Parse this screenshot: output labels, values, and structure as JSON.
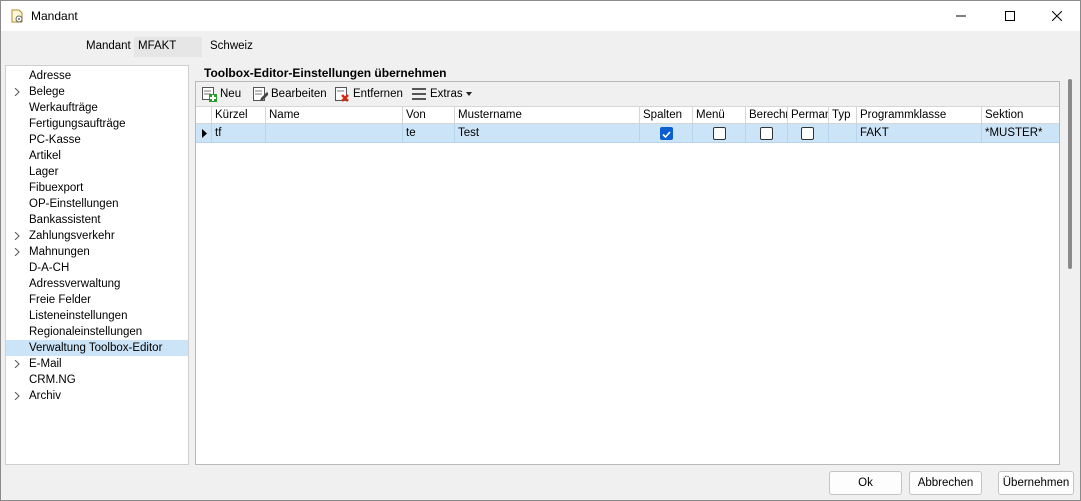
{
  "window": {
    "title": "Mandant"
  },
  "mandant": {
    "label": "Mandant",
    "code": "MFAKT",
    "name": "Schweiz"
  },
  "nav": {
    "items": [
      {
        "label": "Adresse",
        "expandable": false
      },
      {
        "label": "Belege",
        "expandable": true
      },
      {
        "label": "Werkaufträge",
        "expandable": false
      },
      {
        "label": "Fertigungsaufträge",
        "expandable": false
      },
      {
        "label": "PC-Kasse",
        "expandable": false
      },
      {
        "label": "Artikel",
        "expandable": false
      },
      {
        "label": "Lager",
        "expandable": false
      },
      {
        "label": "Fibuexport",
        "expandable": false
      },
      {
        "label": "OP-Einstellungen",
        "expandable": false
      },
      {
        "label": "Bankassistent",
        "expandable": false
      },
      {
        "label": "Zahlungsverkehr",
        "expandable": true
      },
      {
        "label": "Mahnungen",
        "expandable": true
      },
      {
        "label": "D-A-CH",
        "expandable": false
      },
      {
        "label": "Adressverwaltung",
        "expandable": false
      },
      {
        "label": "Freie Felder",
        "expandable": false
      },
      {
        "label": "Listeneinstellungen",
        "expandable": false
      },
      {
        "label": "Regionaleinstellungen",
        "expandable": false
      },
      {
        "label": "Verwaltung Toolbox-Editor",
        "expandable": false,
        "selected": true
      },
      {
        "label": "E-Mail",
        "expandable": true
      },
      {
        "label": "CRM.NG",
        "expandable": false
      },
      {
        "label": "Archiv",
        "expandable": true
      }
    ]
  },
  "panel": {
    "title": "Toolbox-Editor-Einstellungen übernehmen"
  },
  "toolbar": {
    "new": "Neu",
    "edit": "Bearbeiten",
    "remove": "Entfernen",
    "extras": "Extras"
  },
  "table": {
    "columns": [
      "Kürzel",
      "Name",
      "Von",
      "Mustername",
      "Spalten",
      "Menü",
      "Berechn",
      "Permane",
      "Typ",
      "Programmklasse",
      "Sektion"
    ],
    "rows": [
      {
        "kuerzel": "tf",
        "name": "",
        "von": "te",
        "mustername": "Test",
        "spalten": true,
        "menue": false,
        "berechn": false,
        "permanent": false,
        "typ": "",
        "programmklasse": "FAKT",
        "sektion": "*MUSTER*"
      }
    ]
  },
  "buttons": {
    "ok": "Ok",
    "cancel": "Abbrechen",
    "apply": "Übernehmen"
  },
  "colors": {
    "selection": "#cce4f7",
    "checkbox": "#0a5fd0"
  }
}
